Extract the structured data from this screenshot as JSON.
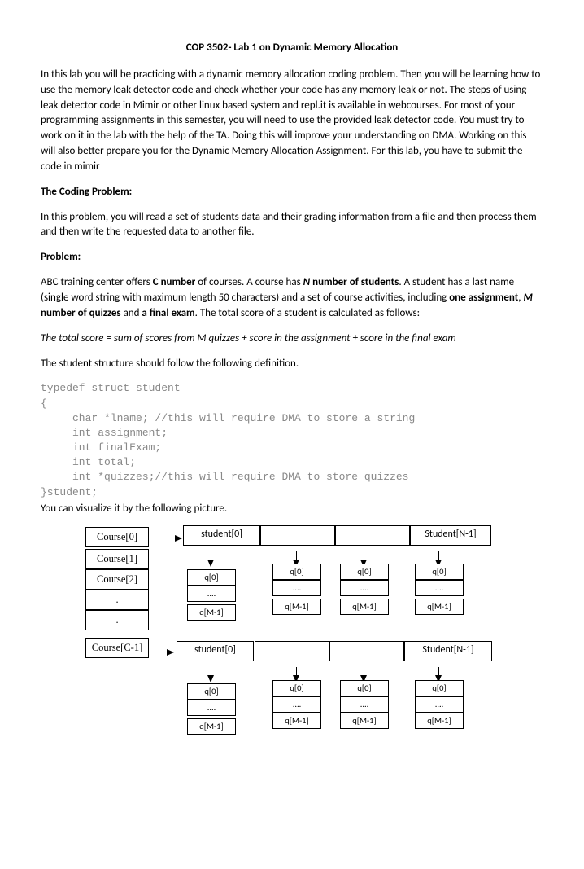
{
  "title": "COP 3502- Lab 1 on Dynamic Memory Allocation",
  "intro": "In this lab you will be practicing with a dynamic memory allocation coding problem. Then you will be learning how to use the memory leak detector code and check whether your code has any memory leak or not. The steps of using leak detector code in Mimir or other linux based system and repl.it is available in webcourses. For most of your programming assignments in this semester, you will need to use the provided leak detector code. You must try to work on it in the lab with the help of the TA. Doing this will improve your understanding on DMA. Working on this will also better prepare you for the Dynamic Memory Allocation Assignment. For this lab, you have to submit the code in mimir",
  "heading_coding": "The Coding Problem:",
  "coding_para": "In this problem, you will read a set of students data and their grading information from a file and then process them and then write the requested data to another file.",
  "heading_problem": "Problem:",
  "problem_p1_a": "ABC training center offers ",
  "problem_p1_b": "C number",
  "problem_p1_c": " of courses. A course has ",
  "problem_p1_d": "N",
  "problem_p1_e": " number of students",
  "problem_p1_f": ". A student has a last name (single word string with maximum length 50 characters) and a set of course activities, including ",
  "problem_p1_g": "one assignment",
  "problem_p1_h": ", ",
  "problem_p1_i": "M",
  "problem_p1_j": " number of quizzes",
  "problem_p1_k": " and ",
  "problem_p1_l": "a final exam",
  "problem_p1_m": ". The total score of a student is calculated as follows:",
  "formula": "The total score = sum of scores from M quizzes + score in the assignment + score in the final exam",
  "struct_intro": "The student structure should follow the following definition.",
  "code": "typedef struct student\n{\n     char *lname; //this will require DMA to store a string\n     int assignment;\n     int finalExam;\n     int total;\n     int *quizzes;//this will require DMA to store quizzes\n}student;",
  "visualize": "You can visualize it by the following picture.",
  "diagram": {
    "courses": [
      "Course[0]",
      "Course[1]",
      "Course[2]",
      ".",
      ".",
      "Course[C-1]"
    ],
    "studentTop": [
      "student[0]",
      "",
      "",
      "Student[N-1]"
    ],
    "studentBot": [
      "student[0]",
      "",
      "",
      "Student[N-1]"
    ],
    "qTop": "q[0]",
    "qDots": "....",
    "qBot": "q[M-1]"
  }
}
